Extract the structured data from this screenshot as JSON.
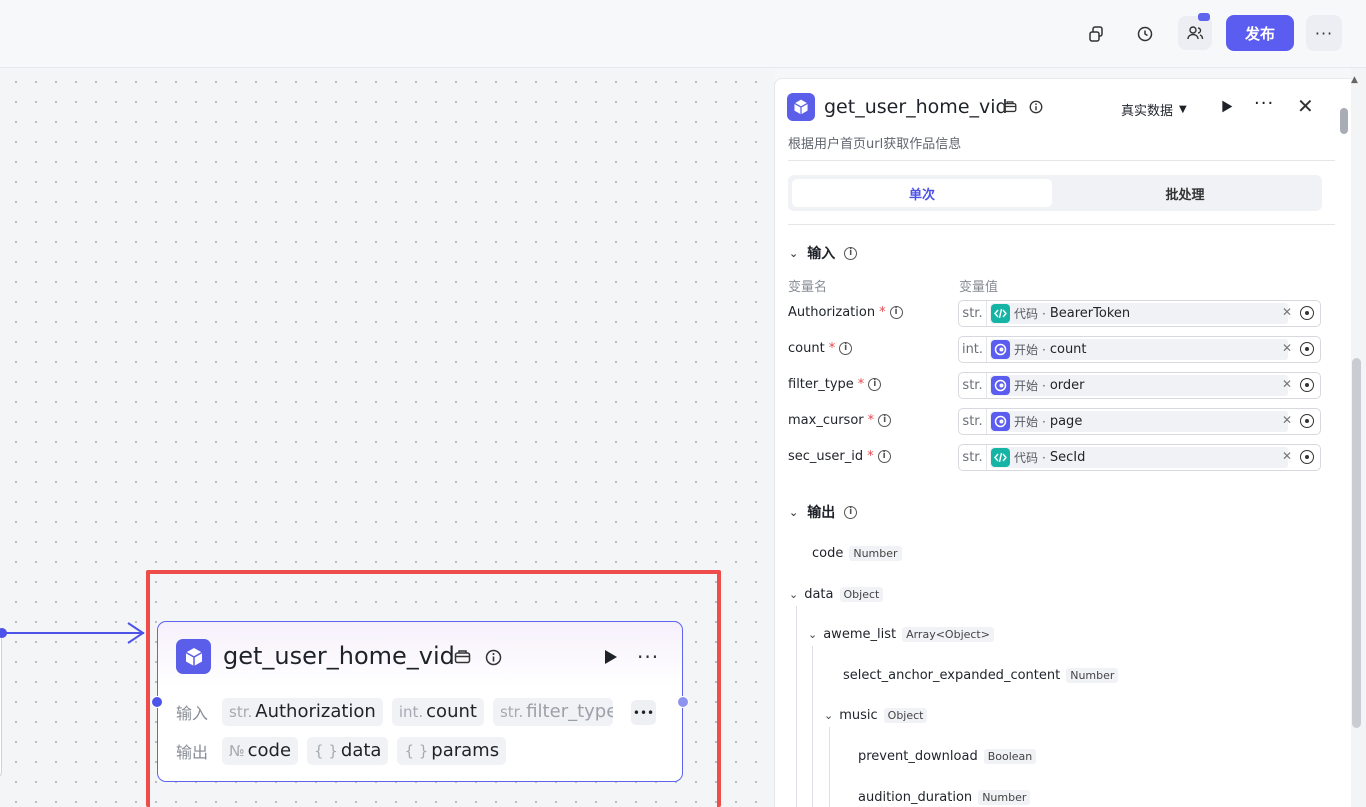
{
  "topbar": {
    "publish_label": "发布",
    "more_label": "···"
  },
  "node_card": {
    "title": "get_user_home_vid",
    "input_label": "输入",
    "output_label": "输出",
    "inputs": [
      {
        "type": "str.",
        "name": "Authorization"
      },
      {
        "type": "int.",
        "name": "count"
      },
      {
        "type": "str.",
        "name": "filter_type"
      }
    ],
    "outputs": [
      {
        "type": "№",
        "name": "code"
      },
      {
        "type": "{ }",
        "name": "data"
      },
      {
        "type": "{ }",
        "name": "params"
      }
    ],
    "more_label": "···"
  },
  "panel": {
    "title": "get_user_home_vid",
    "mode_label": "真实数据",
    "description": "根据用户首页url获取作品信息",
    "tabs": [
      {
        "label": "单次",
        "active": true
      },
      {
        "label": "批处理",
        "active": false
      }
    ],
    "input_section": {
      "title": "输入",
      "col_name": "变量名",
      "col_value": "变量值",
      "rows": [
        {
          "name": "Authorization",
          "type": "str.",
          "source_kind": "code",
          "source": "代码",
          "field": "BearerToken"
        },
        {
          "name": "count",
          "type": "int.",
          "source_kind": "start",
          "source": "开始",
          "field": "count"
        },
        {
          "name": "filter_type",
          "type": "str.",
          "source_kind": "start",
          "source": "开始",
          "field": "order"
        },
        {
          "name": "max_cursor",
          "type": "str.",
          "source_kind": "start",
          "source": "开始",
          "field": "page"
        },
        {
          "name": "sec_user_id",
          "type": "str.",
          "source_kind": "code",
          "source": "代码",
          "field": "SecId"
        }
      ]
    },
    "output_section": {
      "title": "输出",
      "rows": [
        {
          "name": "code",
          "type": "Number"
        },
        {
          "name": "data",
          "type": "Object"
        },
        {
          "name": "aweme_list",
          "type": "Array<Object>"
        },
        {
          "name": "select_anchor_expanded_content",
          "type": "Number"
        },
        {
          "name": "music",
          "type": "Object"
        },
        {
          "name": "prevent_download",
          "type": "Boolean"
        },
        {
          "name": "audition_duration",
          "type": "Number"
        }
      ]
    }
  },
  "colors": {
    "accent": "#5b5cf0",
    "highlight": "#ef4c4c",
    "code_badge": "#16b4a4"
  }
}
